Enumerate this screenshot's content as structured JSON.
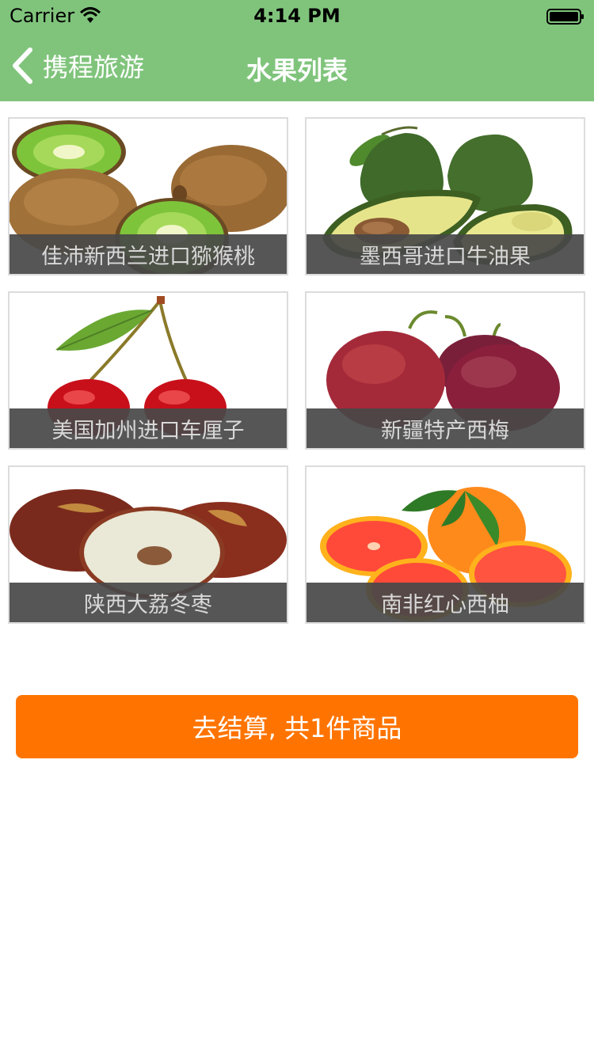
{
  "status_bar": {
    "carrier": "Carrier",
    "time": "4:14 PM"
  },
  "nav": {
    "back_label": "携程旅游",
    "title": "水果列表"
  },
  "products": [
    {
      "name": "佳沛新西兰进口猕猴桃",
      "image": "kiwi"
    },
    {
      "name": "墨西哥进口牛油果",
      "image": "avocado"
    },
    {
      "name": "美国加州进口车厘子",
      "image": "cherry"
    },
    {
      "name": "新疆特产西梅",
      "image": "plum"
    },
    {
      "name": "陕西大荔冬枣",
      "image": "jujube"
    },
    {
      "name": "南非红心西柚",
      "image": "grapefruit"
    }
  ],
  "checkout": {
    "label": "去结算, 共1件商品"
  },
  "colors": {
    "nav_bar": "#80c47c",
    "checkout_button": "#ff7400",
    "caption_overlay": "#484848"
  }
}
